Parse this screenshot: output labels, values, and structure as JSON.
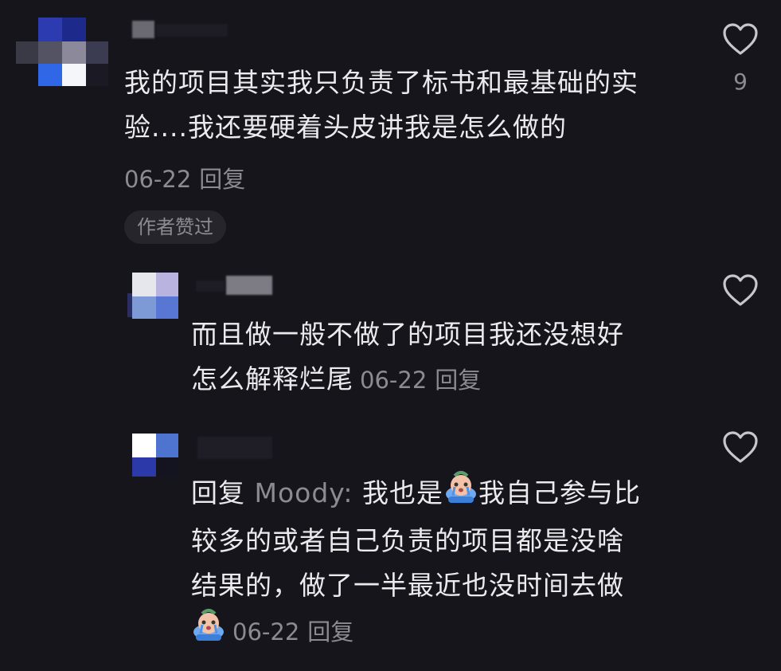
{
  "comments": [
    {
      "text": "我的项目其实我只负责了标书和最基础的实验....我还要硬着头皮讲我是怎么做的",
      "line1": "我的项目其实我只负责了标书和最基础的实",
      "line2": "验....我还要硬着头皮讲我是怎么做的",
      "date": "06-22",
      "reply_label": "回复",
      "badge": "作者赞过",
      "likes": "9"
    },
    {
      "line1": "而且做一般不做了的项目我还没想好",
      "line2": "怎么解释烂尾",
      "date": "06-22",
      "reply_label": "回复"
    },
    {
      "reply_prefix": "回复",
      "mention": "Moody:",
      "line1_rest": "我也是",
      "line1_after_emoji": "我自己参与比",
      "line2": "较多的或者自己负责的项目都是没啥",
      "line3": "结果的，做了一半最近也没时间去做",
      "date": "06-22",
      "reply_label": "回复",
      "emoji": "crying-emoji"
    }
  ],
  "colors": {
    "background": "#16151c",
    "text": "#ebebee",
    "muted": "#8c8b92",
    "badge_bg": "#26252c"
  },
  "icons": [
    "heart-icon",
    "crying-emoji",
    "avatar-blurred"
  ]
}
